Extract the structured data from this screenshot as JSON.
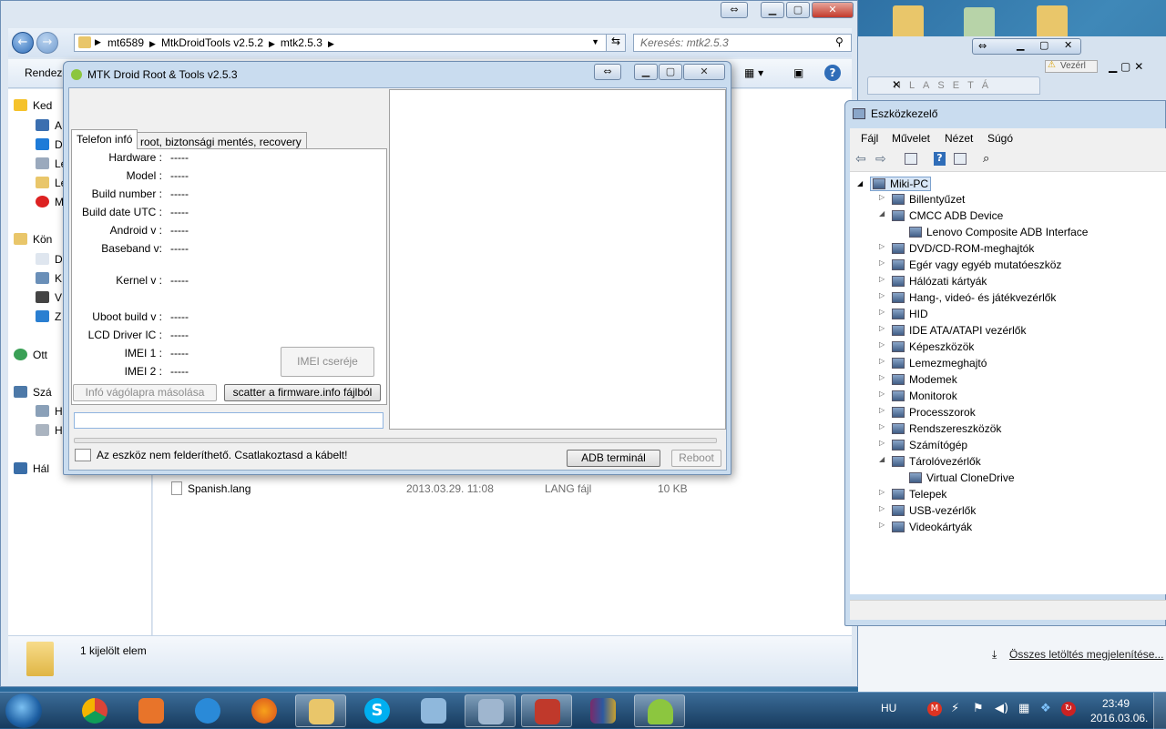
{
  "explorer": {
    "breadcrumb": [
      "mt6589",
      "MtkDroidTools v2.5.2",
      "mtk2.5.3"
    ],
    "search_placeholder": "Keresés: mtk2.5.3",
    "organize_label": "Rendeze",
    "nav_items": [
      "Ked",
      "A",
      "D",
      "Le",
      "Le",
      "M",
      "Kön",
      "D",
      "K",
      "V",
      "Z",
      "Ott",
      "Szá",
      "H",
      "H",
      "Hál"
    ],
    "file_row": {
      "name": "Spanish.lang",
      "date": "2013.03.29. 11:08",
      "type": "LANG fájl",
      "size": "10 KB"
    },
    "details_text": "1 kijelölt elem"
  },
  "mtk": {
    "title": "MTK Droid Root & Tools v2.5.3",
    "tabs": [
      "Telefon infó",
      "root, biztonsági mentés, recovery"
    ],
    "fields": [
      {
        "label": "Hardware :",
        "value": "-----"
      },
      {
        "label": "Model :",
        "value": "-----"
      },
      {
        "label": "Build number :",
        "value": "-----"
      },
      {
        "label": "Build date UTC :",
        "value": "-----"
      },
      {
        "label": "Android  v :",
        "value": "-----"
      },
      {
        "label": "Baseband v:",
        "value": "-----"
      },
      {
        "label": "Kernel v :",
        "value": "-----"
      },
      {
        "label": "Uboot build v :",
        "value": "-----"
      },
      {
        "label": "LCD Driver IC :",
        "value": "-----"
      },
      {
        "label": "IMEI 1 :",
        "value": "-----"
      },
      {
        "label": "IMEI 2 :",
        "value": "-----"
      }
    ],
    "imei_button": "IMEI cseréje",
    "copy_button": "Infó vágólapra másolása",
    "scatter_button": "scatter a firmware.info fájlból",
    "status_text": "Az eszköz nem felderíthető. Csatlakoztasd a kábelt!",
    "adb_button": "ADB terminál",
    "reboot_button": "Reboot"
  },
  "devmgr": {
    "title": "Eszközkezelő",
    "menu": [
      "Fájl",
      "Művelet",
      "Nézet",
      "Súgó"
    ],
    "root": "Miki-PC",
    "tree": [
      {
        "label": "Billentyűzet",
        "level": 1,
        "expanded": false
      },
      {
        "label": "CMCC ADB Device",
        "level": 1,
        "expanded": true
      },
      {
        "label": "Lenovo Composite ADB Interface",
        "level": 2
      },
      {
        "label": "DVD/CD-ROM-meghajtók",
        "level": 1,
        "expanded": false
      },
      {
        "label": "Egér vagy egyéb mutatóeszköz",
        "level": 1,
        "expanded": false
      },
      {
        "label": "Hálózati kártyák",
        "level": 1,
        "expanded": false
      },
      {
        "label": "Hang-, videó- és játékvezérlők",
        "level": 1,
        "expanded": false
      },
      {
        "label": "HID",
        "level": 1,
        "expanded": false
      },
      {
        "label": "IDE ATA/ATAPI vezérlők",
        "level": 1,
        "expanded": false
      },
      {
        "label": "Képeszközök",
        "level": 1,
        "expanded": false
      },
      {
        "label": "Lemezmeghajtó",
        "level": 1,
        "expanded": false
      },
      {
        "label": "Modemek",
        "level": 1,
        "expanded": false
      },
      {
        "label": "Monitorok",
        "level": 1,
        "expanded": false
      },
      {
        "label": "Processzorok",
        "level": 1,
        "expanded": false
      },
      {
        "label": "Rendszereszközök",
        "level": 1,
        "expanded": false
      },
      {
        "label": "Számítógép",
        "level": 1,
        "expanded": false
      },
      {
        "label": "Tárolóvezérlők",
        "level": 1,
        "expanded": true
      },
      {
        "label": "Virtual CloneDrive",
        "level": 2
      },
      {
        "label": "Telepek",
        "level": 1,
        "expanded": false
      },
      {
        "label": "USB-vezérlők",
        "level": 1,
        "expanded": false
      },
      {
        "label": "Videokártyák",
        "level": 1,
        "expanded": false
      }
    ]
  },
  "browser": {
    "tab_text": "HLASETÁ",
    "warning_text": "Vezérl",
    "downloads_link": "Összes letöltés megjelenítése..."
  },
  "taskbar": {
    "language": "HU",
    "time": "23:49",
    "date": "2016.03.06."
  }
}
